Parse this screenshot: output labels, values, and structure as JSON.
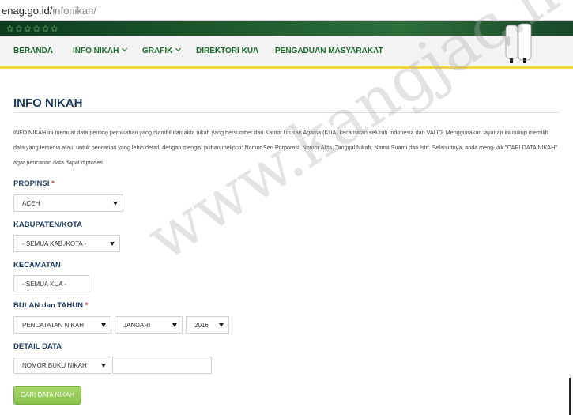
{
  "browser": {
    "url_host": "enag.go.id/",
    "url_path": "infonikah/"
  },
  "nav": {
    "items": [
      {
        "label": "BERANDA",
        "dropdown": false
      },
      {
        "label": "INFO NIKAH",
        "dropdown": true
      },
      {
        "label": "GRAFIK",
        "dropdown": true
      },
      {
        "label": "DIREKTORI KUA",
        "dropdown": false
      },
      {
        "label": "PENGADUAN MASYARAKAT",
        "dropdown": false
      }
    ]
  },
  "page": {
    "title": "INFO NIKAH",
    "intro": "INFO NIKAH ini memuat data penting pernikahan yang diambil dari akta nikah yang bersumber dari Kantor Urusan Agama (KUA) kecamatan seluruh Indonesia dan VALID. Menggunakan layanan ini cukup memilih data yang tersedia atau, untuk pencarian yang lebih detail, dengan mengisi pilihan meliputi: Nomor Seri Porporasi, Nomor Akta, Tanggal Nikah, Nama Suami dan Istri. Selanjutnya, anda meng-klik \"CARI DATA NIKAH\" agar pencarian data dapat diproses."
  },
  "form": {
    "propinsi": {
      "label": "PROPINSI",
      "required": "*",
      "value": "ACEH"
    },
    "kabupaten": {
      "label": "KABUPATEN/KOTA",
      "value": "- SEMUA KAB./KOTA -"
    },
    "kecamatan": {
      "label": "KECAMATAN",
      "value": "- SEMUA KUA -"
    },
    "bulan_tahun": {
      "label": "BULAN dan TAHUN",
      "required": "*",
      "jenis": "PENCATATAN NIKAH",
      "bulan": "JANUARI",
      "tahun": "2016"
    },
    "detail": {
      "label": "DETAIL DATA",
      "jenis": "NOMOR BUKU NIKAH",
      "value": ""
    },
    "submit_label": "CARI DATA NIKAH"
  },
  "watermark": "www.kangjac.net",
  "colors": {
    "nav_text": "#1b6b2e",
    "title": "#1e3a5c",
    "nav_border": "#f0d34b",
    "button": "#86c04a",
    "required": "#d32f2f"
  }
}
